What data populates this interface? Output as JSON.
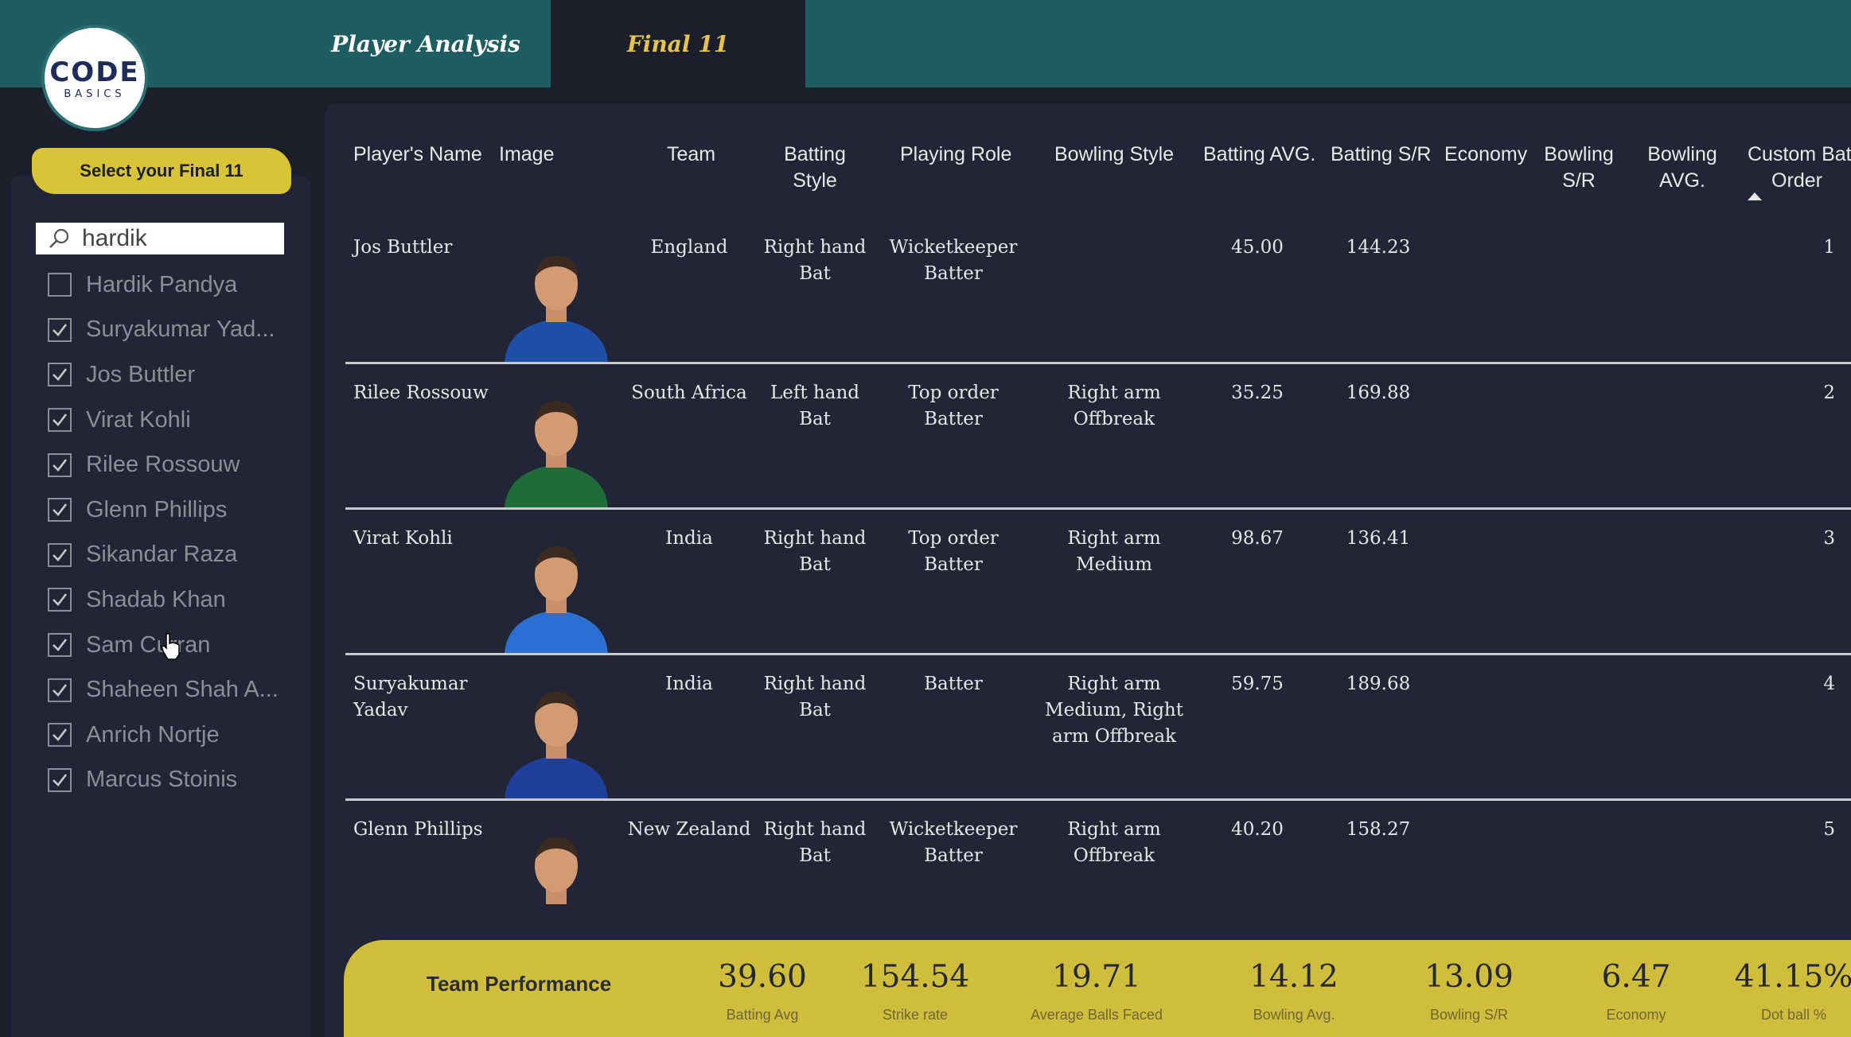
{
  "tabs": [
    {
      "label": "Player Analysis",
      "active": false
    },
    {
      "label": "Final 11",
      "active": true
    }
  ],
  "logo": {
    "main": "CODE",
    "sub": "BASICS"
  },
  "sidebar": {
    "select_button": "Select your Final 11",
    "search": {
      "value": "hardik",
      "placeholder": ""
    },
    "players": [
      {
        "name": "Hardik Pandya",
        "checked": false
      },
      {
        "name": "Suryakumar Yad...",
        "checked": true
      },
      {
        "name": "Jos Buttler",
        "checked": true
      },
      {
        "name": "Virat Kohli",
        "checked": true
      },
      {
        "name": "Rilee Rossouw",
        "checked": true
      },
      {
        "name": "Glenn Phillips",
        "checked": true
      },
      {
        "name": "Sikandar Raza",
        "checked": true
      },
      {
        "name": "Shadab Khan",
        "checked": true
      },
      {
        "name": "Sam Curran",
        "checked": true
      },
      {
        "name": "Shaheen Shah A...",
        "checked": true
      },
      {
        "name": "Anrich Nortje",
        "checked": true
      },
      {
        "name": "Marcus Stoinis",
        "checked": true
      }
    ]
  },
  "table": {
    "headers": {
      "name": "Player's Name",
      "image": "Image",
      "team": "Team",
      "batting_style": [
        "Batting",
        "Style"
      ],
      "role": "Playing Role",
      "bowling_style": "Bowling Style",
      "bat_avg": "Batting AVG.",
      "bat_sr": "Batting S/R",
      "economy": "Economy",
      "bowl_sr": [
        "Bowling",
        "S/R"
      ],
      "bowl_avg": [
        "Bowling",
        "AVG."
      ],
      "order": [
        "Custom Bat",
        "Order"
      ]
    },
    "rows": [
      {
        "name": [
          "Jos Buttler"
        ],
        "team": "England",
        "batting_style": [
          "Right hand",
          "Bat"
        ],
        "role": [
          "Wicketkeeper",
          "Batter"
        ],
        "bowling_style": [],
        "bat_avg": "45.00",
        "bat_sr": "144.23",
        "economy": "",
        "bowl_sr": "",
        "bowl_avg": "",
        "order": "1",
        "jersey": "#1f4fa8"
      },
      {
        "name": [
          "Rilee Rossouw"
        ],
        "team": "South Africa",
        "batting_style": [
          "Left hand",
          "Bat"
        ],
        "role": [
          "Top order",
          "Batter"
        ],
        "bowling_style": [
          "Right arm",
          "Offbreak"
        ],
        "bat_avg": "35.25",
        "bat_sr": "169.88",
        "economy": "",
        "bowl_sr": "",
        "bowl_avg": "",
        "order": "2",
        "jersey": "#1f6b3a"
      },
      {
        "name": [
          "Virat Kohli"
        ],
        "team": "India",
        "batting_style": [
          "Right hand",
          "Bat"
        ],
        "role": [
          "Top order",
          "Batter"
        ],
        "bowling_style": [
          "Right arm",
          "Medium"
        ],
        "bat_avg": "98.67",
        "bat_sr": "136.41",
        "economy": "",
        "bowl_sr": "",
        "bowl_avg": "",
        "order": "3",
        "jersey": "#2a6fd1"
      },
      {
        "name": [
          "Suryakumar",
          "Yadav"
        ],
        "team": "India",
        "batting_style": [
          "Right hand",
          "Bat"
        ],
        "role": [
          "Batter"
        ],
        "bowling_style": [
          "Right arm",
          "Medium, Right",
          "arm Offbreak"
        ],
        "bat_avg": "59.75",
        "bat_sr": "189.68",
        "economy": "",
        "bowl_sr": "",
        "bowl_avg": "",
        "order": "4",
        "jersey": "#1e3f9a"
      },
      {
        "name": [
          "Glenn Phillips"
        ],
        "team": "New Zealand",
        "batting_style": [
          "Right hand",
          "Bat"
        ],
        "role": [
          "Wicketkeeper",
          "Batter"
        ],
        "bowling_style": [
          "Right arm",
          "Offbreak"
        ],
        "bat_avg": "40.20",
        "bat_sr": "158.27",
        "economy": "",
        "bowl_sr": "",
        "bowl_avg": "",
        "order": "5",
        "jersey": "#2a2f3a"
      }
    ]
  },
  "performance": {
    "title": "Team Performance",
    "kpis": [
      {
        "value": "39.60",
        "label": "Batting Avg"
      },
      {
        "value": "154.54",
        "label": "Strike rate"
      },
      {
        "value": "19.71",
        "label": "Average Balls Faced"
      },
      {
        "value": "14.12",
        "label": "Bowling Avg."
      },
      {
        "value": "13.09",
        "label": "Bowling S/R"
      },
      {
        "value": "6.47",
        "label": "Economy"
      },
      {
        "value": "41.15%",
        "label": "Dot ball %"
      }
    ]
  },
  "colors": {
    "accent_yellow": "#d9c437",
    "tab_active_text": "#e8c34a",
    "topbar": "#1e5e62"
  }
}
